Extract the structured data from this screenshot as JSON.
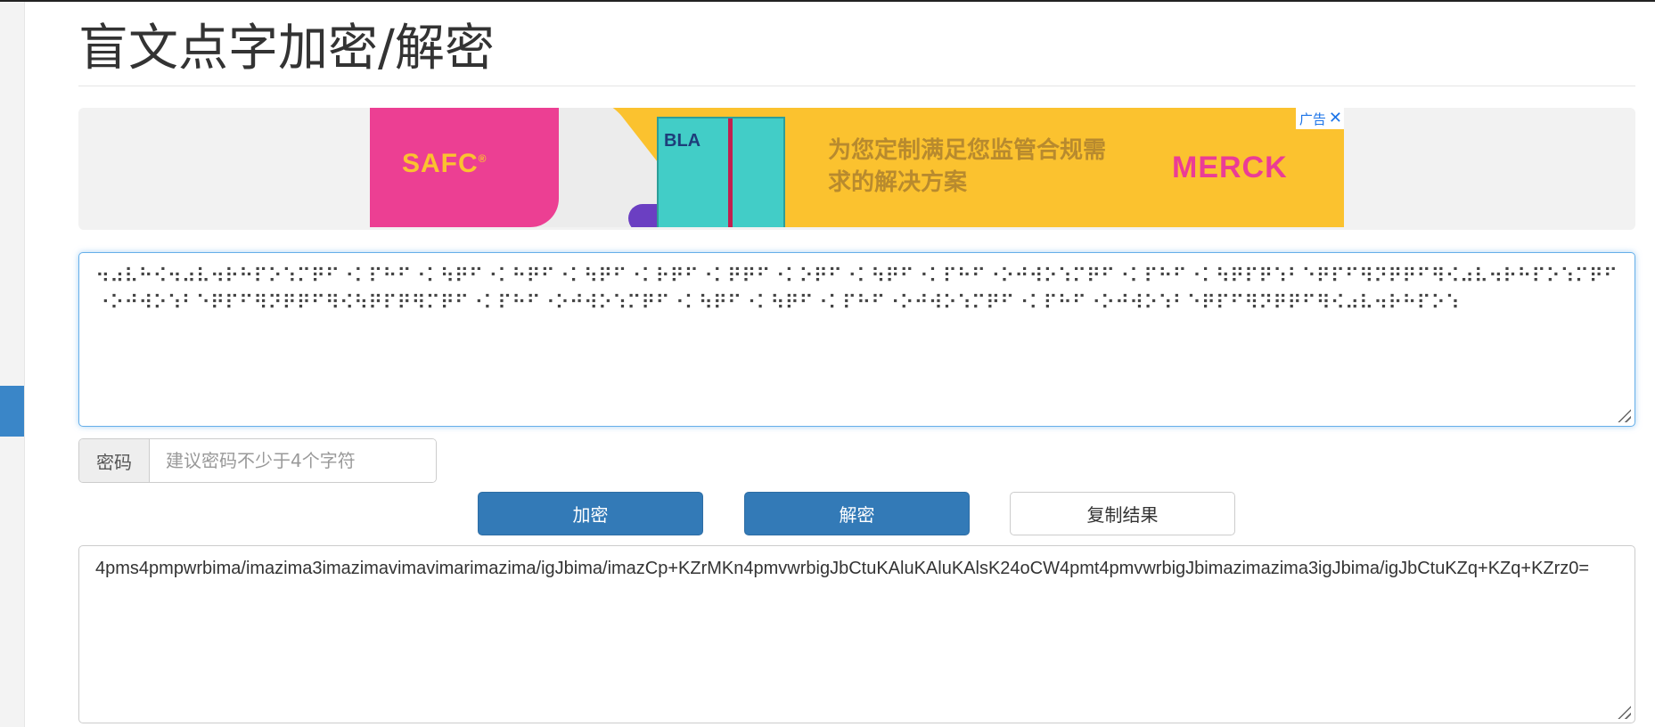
{
  "page": {
    "title": "盲文点字加密/解密"
  },
  "ad": {
    "brand_left": "SAFC",
    "brand_left_mark": "®",
    "box_text": "BLA",
    "slogan": "为您定制满足您监管合规需求的解决方案",
    "brand_right": "MERCK",
    "badge_label": "广告",
    "close_glyph": "✕"
  },
  "braille_input": {
    "value": "⠲⠴⠧⠓⠪⠲⠴⠧⠲⠗⠓⠏⠕⠱⠍⠟⠋⠐⠅⠏⠓⠋⠐⠅⠳⠟⠋⠐⠅⠓⠟⠋⠐⠅⠳⠟⠋⠐⠅⠗⠟⠋⠐⠅⠟⠟⠋⠐⠅⠕⠟⠋⠐⠅⠳⠟⠋⠐⠅⠏⠓⠋⠐⠕⠚⠺⠕⠱⠍⠟⠋⠐⠅⠏⠓⠋⠐⠅⠳⠟⠏⠟⠱⠃⠑⠟⠏⠋⠻⠝⠟⠟⠋⠻⠪⠴⠧⠲⠗⠓⠏⠕⠱⠍⠟⠋⠐⠕⠚⠺⠕⠱⠃⠑⠟⠏⠋⠻⠝⠟⠟⠋⠻⠪⠳⠟⠏⠟⠻⠍⠟⠋⠐⠅⠏⠓⠋⠐⠕⠚⠺⠕⠱⠍⠟⠋⠐⠅⠳⠟⠋⠐⠅⠳⠟⠋⠐⠅⠏⠓⠋⠐⠕⠚⠺⠕⠱⠍⠟⠋⠐⠅⠏⠓⠋⠐⠕⠚⠺⠕⠱⠃⠑⠟⠏⠋⠻⠝⠟⠟⠋⠻⠪⠴⠧⠲⠗⠓⠏⠕⠱"
  },
  "password": {
    "label": "密码",
    "placeholder": "建议密码不少于4个字符",
    "value": ""
  },
  "buttons": {
    "encrypt": "加密",
    "decrypt": "解密",
    "copy": "复制结果"
  },
  "result": {
    "value": "4pms4pmpwrbima/imazima3imazimavimavimarimazima/igJbima/imazCp+KZrMKn4pmvwrbigJbCtuKAluKAluKAlsK24oCW4pmt4pmvwrbigJbimazimazima3igJbima/igJbCtuKZq+KZq+KZrz0="
  },
  "colors": {
    "primary": "#337ab7",
    "focus_border": "#66afe9",
    "ad_yellow": "#fbc22f",
    "ad_pink": "#ec3f93"
  }
}
